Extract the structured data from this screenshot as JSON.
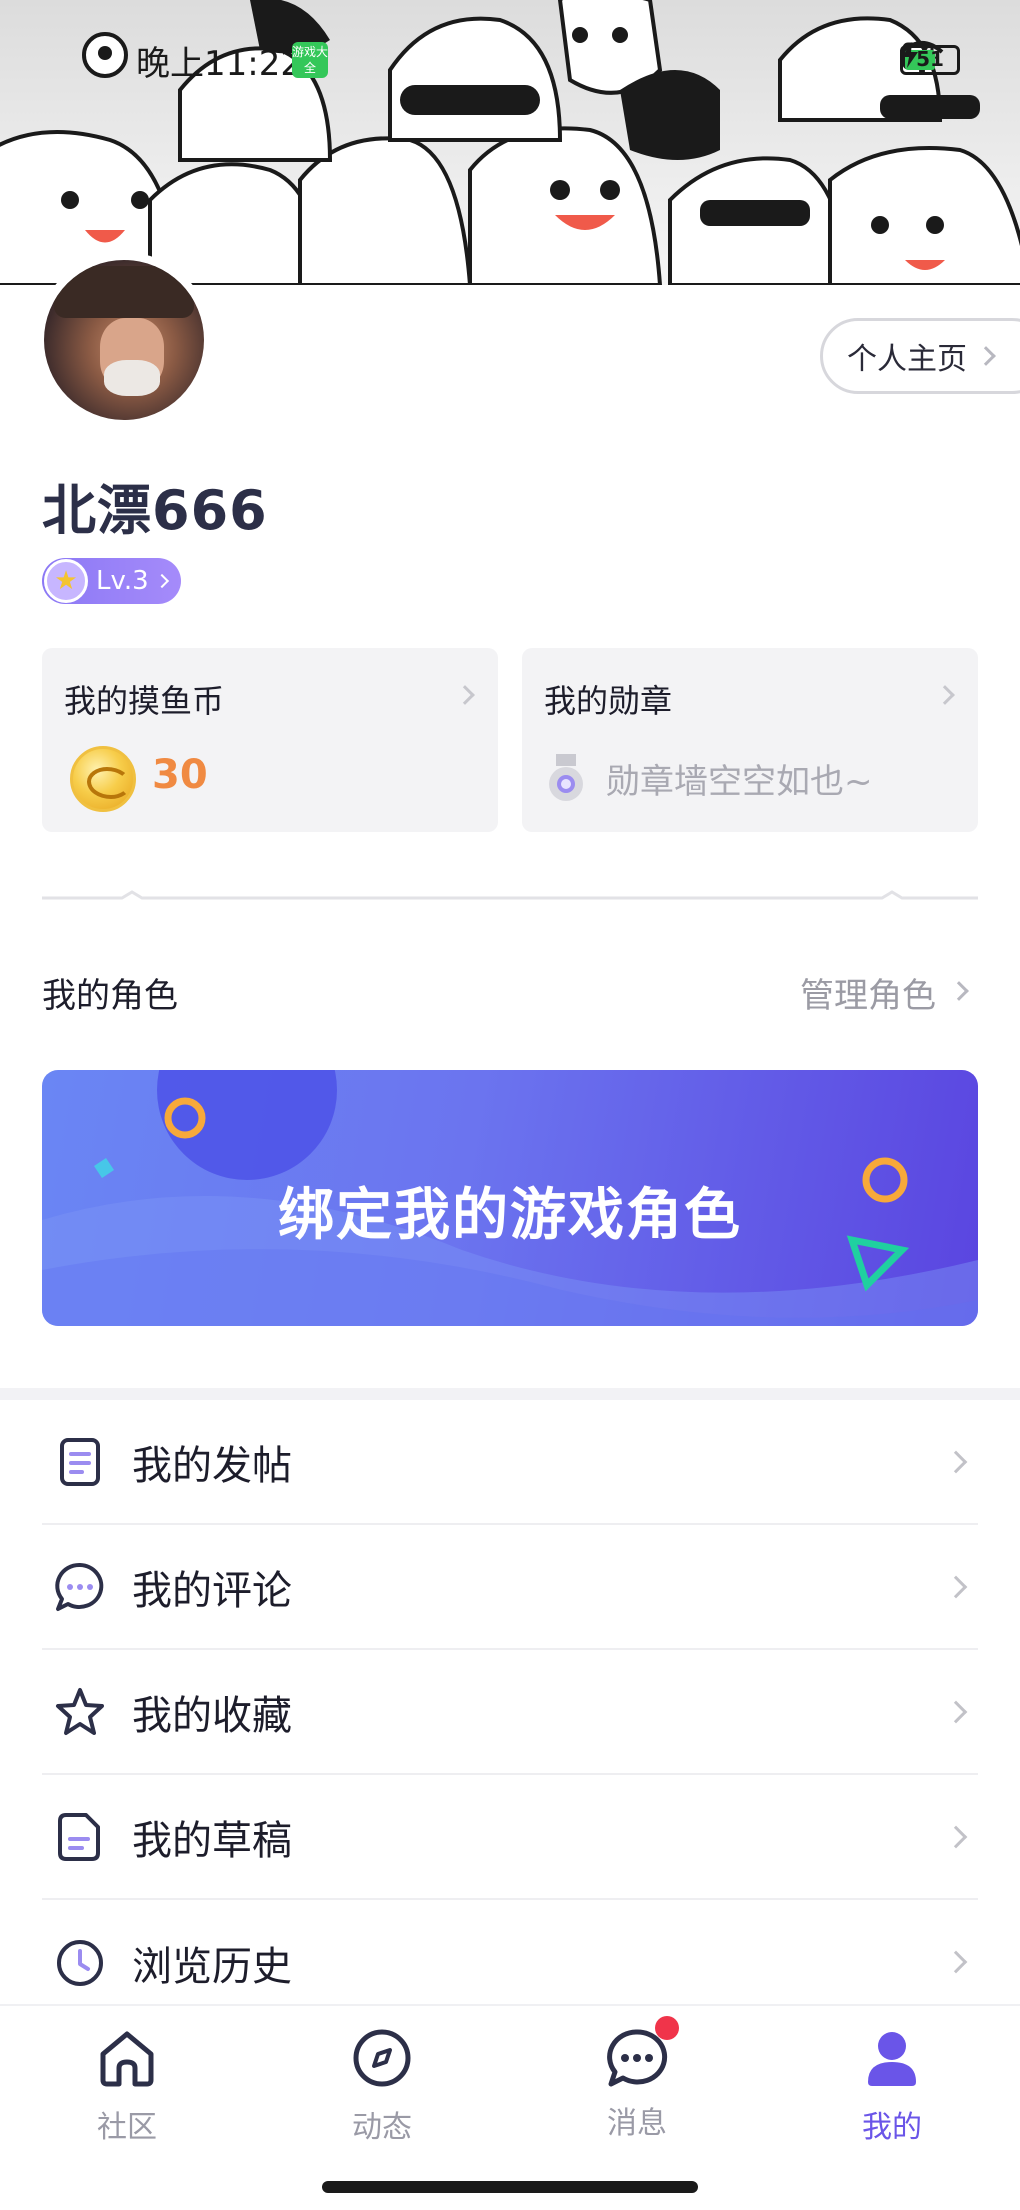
{
  "status_bar": {
    "time": "晚上11:22",
    "app_badge": "游戏大全",
    "battery_level": "51"
  },
  "profile": {
    "homepage_button": "个人主页",
    "username": "北漂666",
    "level": "Lv.3"
  },
  "cards": {
    "coins": {
      "title": "我的摸鱼币",
      "value": "30"
    },
    "medals": {
      "title": "我的勋章",
      "empty_text": "勋章墙空空如也~"
    }
  },
  "roles": {
    "title": "我的角色",
    "manage": "管理角色",
    "bind_banner": "绑定我的游戏角色"
  },
  "menu": [
    {
      "label": "我的发帖",
      "icon": "document-icon"
    },
    {
      "label": "我的评论",
      "icon": "comment-icon"
    },
    {
      "label": "我的收藏",
      "icon": "star-icon"
    },
    {
      "label": "我的草稿",
      "icon": "draft-icon"
    },
    {
      "label": "浏览历史",
      "icon": "clock-icon"
    }
  ],
  "bottom_nav": [
    {
      "label": "社区",
      "icon": "home-icon",
      "active": false
    },
    {
      "label": "动态",
      "icon": "compass-icon",
      "active": false
    },
    {
      "label": "消息",
      "icon": "message-icon",
      "active": false,
      "has_badge": true
    },
    {
      "label": "我的",
      "icon": "user-icon",
      "active": true
    }
  ],
  "colors": {
    "accent": "#6a55e8",
    "coin_value": "#f08a42",
    "badge_red": "#f0344a",
    "banner_start": "#6a86f4",
    "banner_end": "#5a45e0"
  }
}
